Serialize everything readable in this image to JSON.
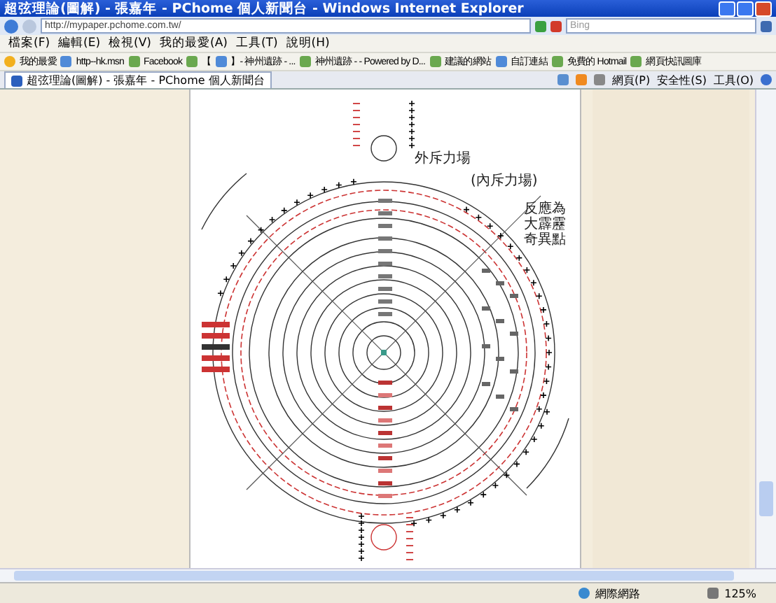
{
  "window": {
    "title": "超弦理論(圖解) - 張嘉年 - PChome 個人新聞台 - Windows Internet Explorer"
  },
  "address_bar": {
    "url": "http://mypaper.pchome.com.tw/"
  },
  "search": {
    "placeholder": "Bing"
  },
  "menu": [
    "檔案(F)",
    "編輯(E)",
    "檢視(V)",
    "我的最愛(A)",
    "工具(T)",
    "說明(H)"
  ],
  "favorites_bar": {
    "label": "我的最愛",
    "items": [
      {
        "label": "http--hk.msn"
      },
      {
        "label": "Facebook"
      },
      {
        "label": "【"
      },
      {
        "label": "】- 神州遺跡 - ..."
      },
      {
        "label": "神州遺跡 - - Powered by D..."
      },
      {
        "label": "建議的網站"
      },
      {
        "label": "自訂連結"
      },
      {
        "label": "免費的 Hotmail"
      },
      {
        "label": "網頁快訊圖庫"
      }
    ]
  },
  "tabs": [
    {
      "label": "超弦理論(圖解) - 張嘉年 - PChome 個人新聞台",
      "selected": true
    }
  ],
  "command_bar": [
    "網頁(P)",
    "安全性(S)",
    "工具(O)"
  ],
  "diagram": {
    "labels": [
      "外斥力場",
      "(內斥力場)"
    ],
    "note": [
      "反應為",
      "大霹靂",
      "奇異點"
    ]
  },
  "status_bar": {
    "zone": "網際網路",
    "zoom": "125%"
  }
}
